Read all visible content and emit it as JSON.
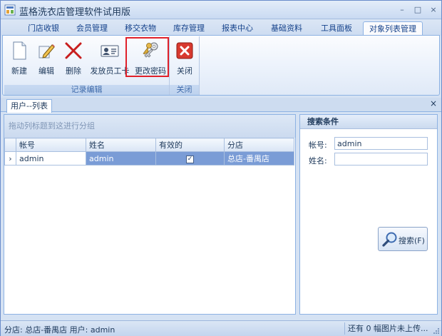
{
  "window": {
    "title": "蓝格洗衣店管理软件试用版",
    "minimize": "–",
    "maximize": "□",
    "close": "×"
  },
  "menu": {
    "tabs": [
      {
        "label": "门店收银"
      },
      {
        "label": "会员管理"
      },
      {
        "label": "移交衣物"
      },
      {
        "label": "库存管理"
      },
      {
        "label": "报表中心"
      },
      {
        "label": "基础资料"
      },
      {
        "label": "工具面板"
      },
      {
        "label": "对象列表管理",
        "active": true
      }
    ]
  },
  "ribbon": {
    "groups": [
      {
        "label": "记录编辑",
        "buttons": [
          {
            "label": "新建",
            "icon": "new-document-icon"
          },
          {
            "label": "编辑",
            "icon": "edit-pencil-icon"
          },
          {
            "label": "删除",
            "icon": "delete-x-icon"
          },
          {
            "label": "发放员工卡",
            "icon": "id-card-icon"
          },
          {
            "label": "更改密码",
            "icon": "keys-icon",
            "highlighted": true
          }
        ]
      },
      {
        "label": "关闭",
        "buttons": [
          {
            "label": "关闭",
            "icon": "close-red-icon"
          }
        ]
      }
    ]
  },
  "doc_tab": {
    "label": "用户--列表",
    "close": "×"
  },
  "grid": {
    "group_hint": "拖动列标题到这进行分组",
    "columns": [
      "帐号",
      "姓名",
      "有效的",
      "分店"
    ],
    "rows": [
      {
        "account": "admin",
        "name": "admin",
        "valid": true,
        "branch": "总店-番禺店",
        "selected": true
      }
    ],
    "row_indicator": "›",
    "check_mark": "✓"
  },
  "search": {
    "title": "搜索条件",
    "account_label": "帐号:",
    "account_value": "admin",
    "name_label": "姓名:",
    "name_value": "",
    "button_label": "搜索(F)"
  },
  "status": {
    "left": "分店: 总店-番禺店  用户: admin",
    "right": "还有 0 幅图片未上传..."
  },
  "colors": {
    "highlight_border": "#e0202a",
    "selected_row": "#7a9cd6",
    "accent": "#15428b"
  }
}
